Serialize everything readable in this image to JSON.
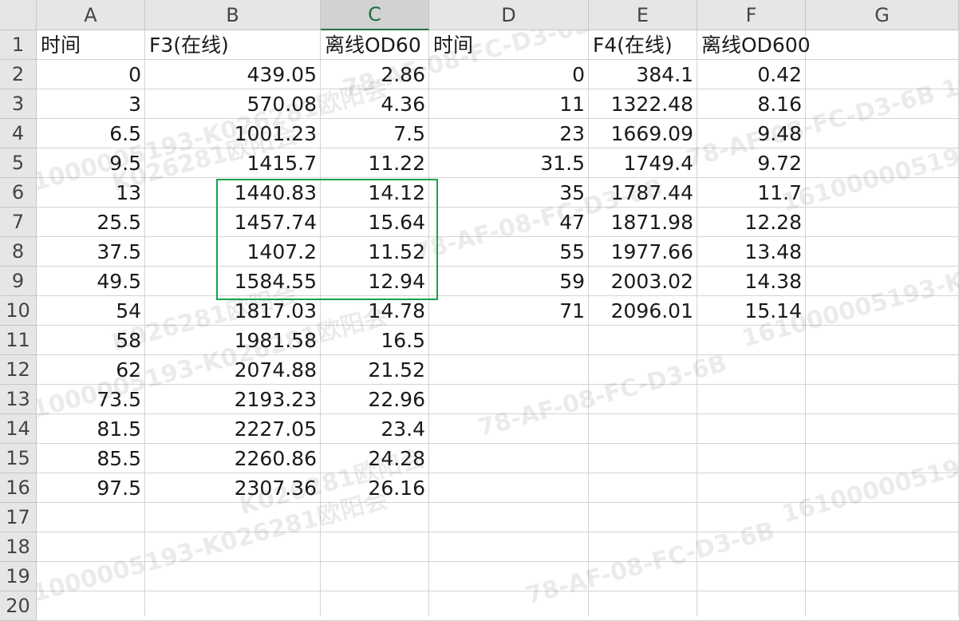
{
  "columns": [
    "A",
    "B",
    "C",
    "D",
    "E",
    "F",
    "G"
  ],
  "selected_column": "C",
  "rows": [
    "1",
    "2",
    "3",
    "4",
    "5",
    "6",
    "7",
    "8",
    "9",
    "10",
    "11",
    "12",
    "13",
    "14",
    "15",
    "16",
    "17",
    "18",
    "19",
    "20"
  ],
  "cells": {
    "A1": "时间",
    "B1": "F3(在线)",
    "C1": "离线OD60",
    "D1": "时间",
    "E1": "F4(在线)",
    "F1": "离线OD600",
    "A2": "0",
    "B2": "439.05",
    "C2": "2.86",
    "D2": "0",
    "E2": "384.1",
    "F2": "0.42",
    "A3": "3",
    "B3": "570.08",
    "C3": "4.36",
    "D3": "11",
    "E3": "1322.48",
    "F3": "8.16",
    "A4": "6.5",
    "B4": "1001.23",
    "C4": "7.5",
    "D4": "23",
    "E4": "1669.09",
    "F4": "9.48",
    "A5": "9.5",
    "B5": "1415.7",
    "C5": "11.22",
    "D5": "31.5",
    "E5": "1749.4",
    "F5": "9.72",
    "A6": "13",
    "B6": "1440.83",
    "C6": "14.12",
    "D6": "35",
    "E6": "1787.44",
    "F6": "11.7",
    "A7": "25.5",
    "B7": "1457.74",
    "C7": "15.64",
    "D7": "47",
    "E7": "1871.98",
    "F7": "12.28",
    "A8": "37.5",
    "B8": "1407.2",
    "C8": "11.52",
    "D8": "55",
    "E8": "1977.66",
    "F8": "13.48",
    "A9": "49.5",
    "B9": "1584.55",
    "C9": "12.94",
    "D9": "59",
    "E9": "2003.02",
    "F9": "14.38",
    "A10": "54",
    "B10": "1817.03",
    "C10": "14.78",
    "D10": "71",
    "E10": "2096.01",
    "F10": "15.14",
    "A11": "58",
    "B11": "1981.58",
    "C11": "16.5",
    "A12": "62",
    "B12": "2074.88",
    "C12": "21.52",
    "A13": "73.5",
    "B13": "2193.23",
    "C13": "22.96",
    "A14": "81.5",
    "B14": "2227.05",
    "C14": "23.4",
    "A15": "85.5",
    "B15": "2260.86",
    "C15": "24.28",
    "A16": "97.5",
    "B16": "2307.36",
    "C16": "26.16"
  },
  "watermarks": [
    "78-AF-08-FC-D3-6B",
    "161000005193-K026281欧阳会",
    "K026281欧阳会",
    "78-AF-08-FC-D3-6B 161000005193-K026281欧阳会"
  ],
  "colors": {
    "selection": "#1aa14f",
    "header_bg": "#e6e6e6",
    "selected_header_text": "#1e6e3e"
  }
}
